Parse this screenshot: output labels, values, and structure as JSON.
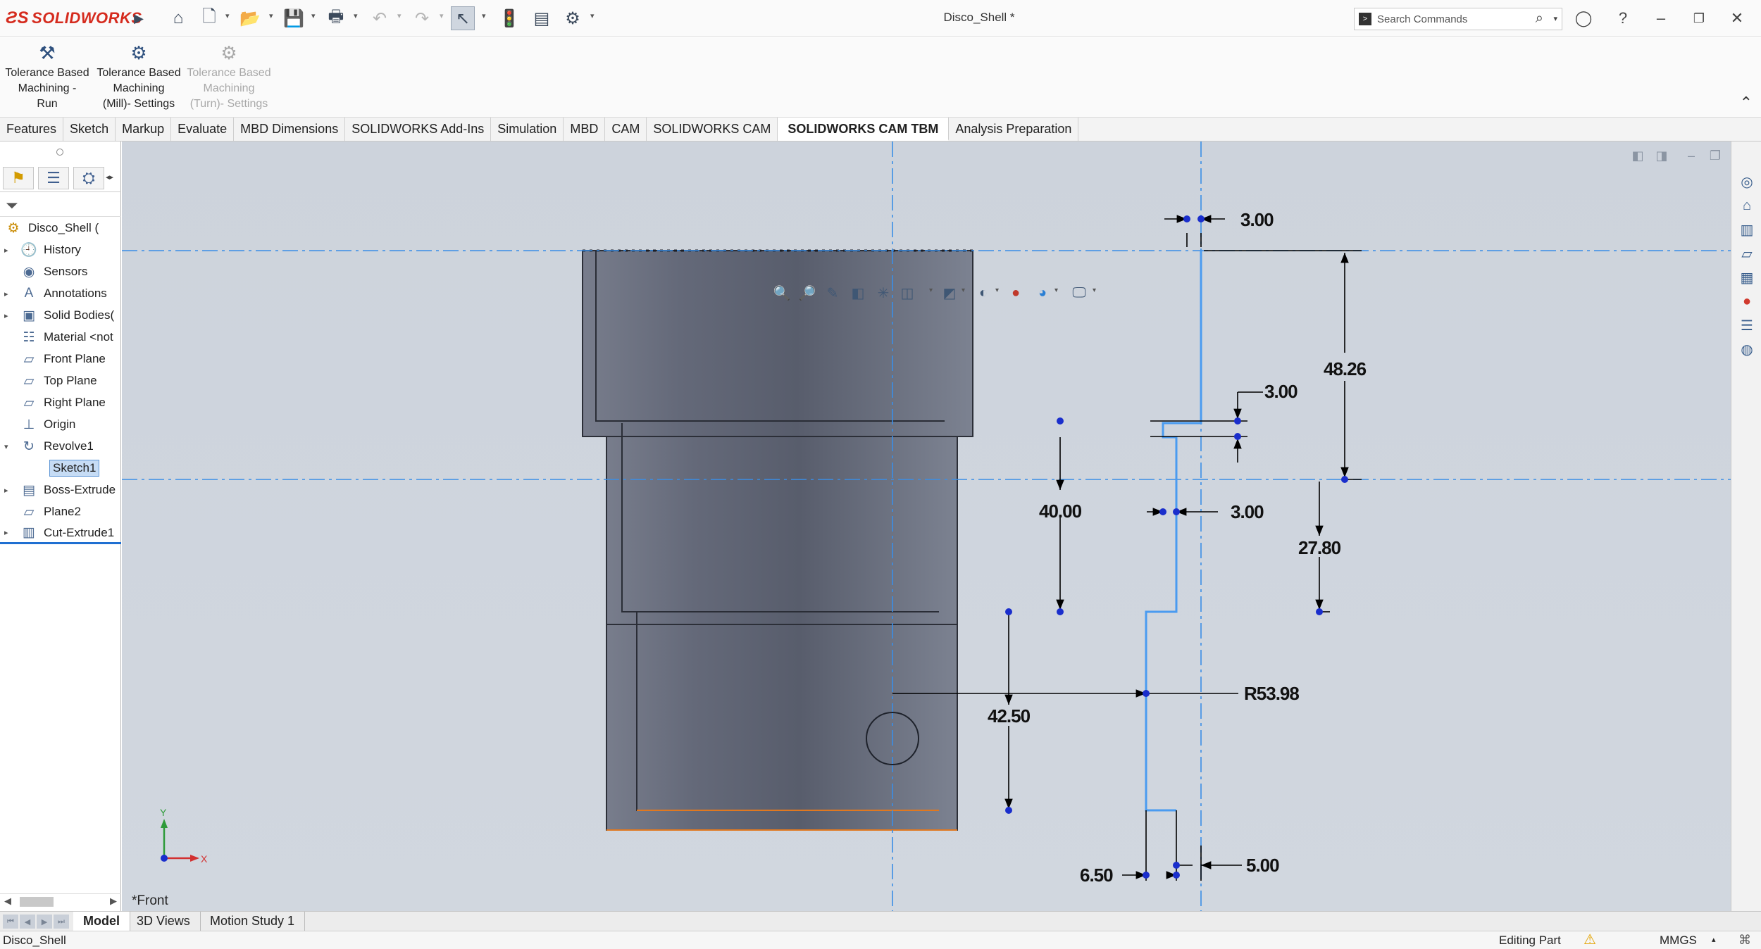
{
  "app": {
    "logo_text": "SOLIDWORKS",
    "document_title": "Disco_Shell *"
  },
  "search": {
    "placeholder": "Search Commands"
  },
  "icons": {
    "home": "home-icon",
    "new": "new-document-icon",
    "open": "open-folder-icon",
    "save": "save-icon",
    "print": "print-icon",
    "undo": "undo-icon",
    "redo": "redo-icon",
    "select": "select-pointer-icon",
    "rebuild": "traffic-light-rebuild-icon",
    "file_properties": "file-properties-icon",
    "options": "gear-icon"
  },
  "command_manager": {
    "buttons": [
      {
        "label": "Tolerance Based\nMachining -\nRun",
        "enabled": true
      },
      {
        "label": "Tolerance Based\nMachining\n(Mill)- Settings",
        "enabled": true
      },
      {
        "label": "Tolerance Based\nMachining\n(Turn)- Settings",
        "enabled": false
      }
    ]
  },
  "tabs": [
    {
      "label": "Features"
    },
    {
      "label": "Sketch"
    },
    {
      "label": "Markup"
    },
    {
      "label": "Evaluate"
    },
    {
      "label": "MBD Dimensions"
    },
    {
      "label": "SOLIDWORKS Add-Ins"
    },
    {
      "label": "Simulation"
    },
    {
      "label": "MBD"
    },
    {
      "label": "CAM"
    },
    {
      "label": "SOLIDWORKS CAM"
    },
    {
      "label": "SOLIDWORKS CAM TBM",
      "active": true
    },
    {
      "label": "Analysis Preparation"
    }
  ],
  "feature_tree": {
    "items": [
      {
        "label": "Disco_Shell  ("
      },
      {
        "label": "History"
      },
      {
        "label": "Sensors"
      },
      {
        "label": "Annotations"
      },
      {
        "label": "Solid Bodies("
      },
      {
        "label": "Material <not"
      },
      {
        "label": "Front Plane"
      },
      {
        "label": "Top Plane"
      },
      {
        "label": "Right Plane"
      },
      {
        "label": "Origin"
      },
      {
        "label": "Revolve1"
      },
      {
        "label": "Sketch1"
      },
      {
        "label": "Boss-Extrude"
      },
      {
        "label": "Plane2"
      },
      {
        "label": "Cut-Extrude1"
      }
    ]
  },
  "graphics": {
    "view_name": "*Front",
    "triad": {
      "x_label": "X",
      "y_label": "Y"
    },
    "dimensions": {
      "d1": "3.00",
      "d2": "48.26",
      "d3": "3.00",
      "d4": "40.00",
      "d5": "3.00",
      "d6": "27.80",
      "d7": "R53.98",
      "d8": "42.50",
      "d9": "6.50",
      "d10": "5.00"
    },
    "colors": {
      "background": "#cdd3dc",
      "centerline": "#3a8ee6",
      "sketch_selected": "#4a9bf0",
      "dimension": "#000000",
      "point": "#1a2ecc",
      "edge_highlight": "#e07820"
    }
  },
  "bottom_tabs": [
    {
      "label": "Model",
      "active": true
    },
    {
      "label": "3D Views"
    },
    {
      "label": "Motion Study 1"
    }
  ],
  "status": {
    "document": "Disco_Shell",
    "mode": "Editing Part",
    "units": "MMGS"
  }
}
